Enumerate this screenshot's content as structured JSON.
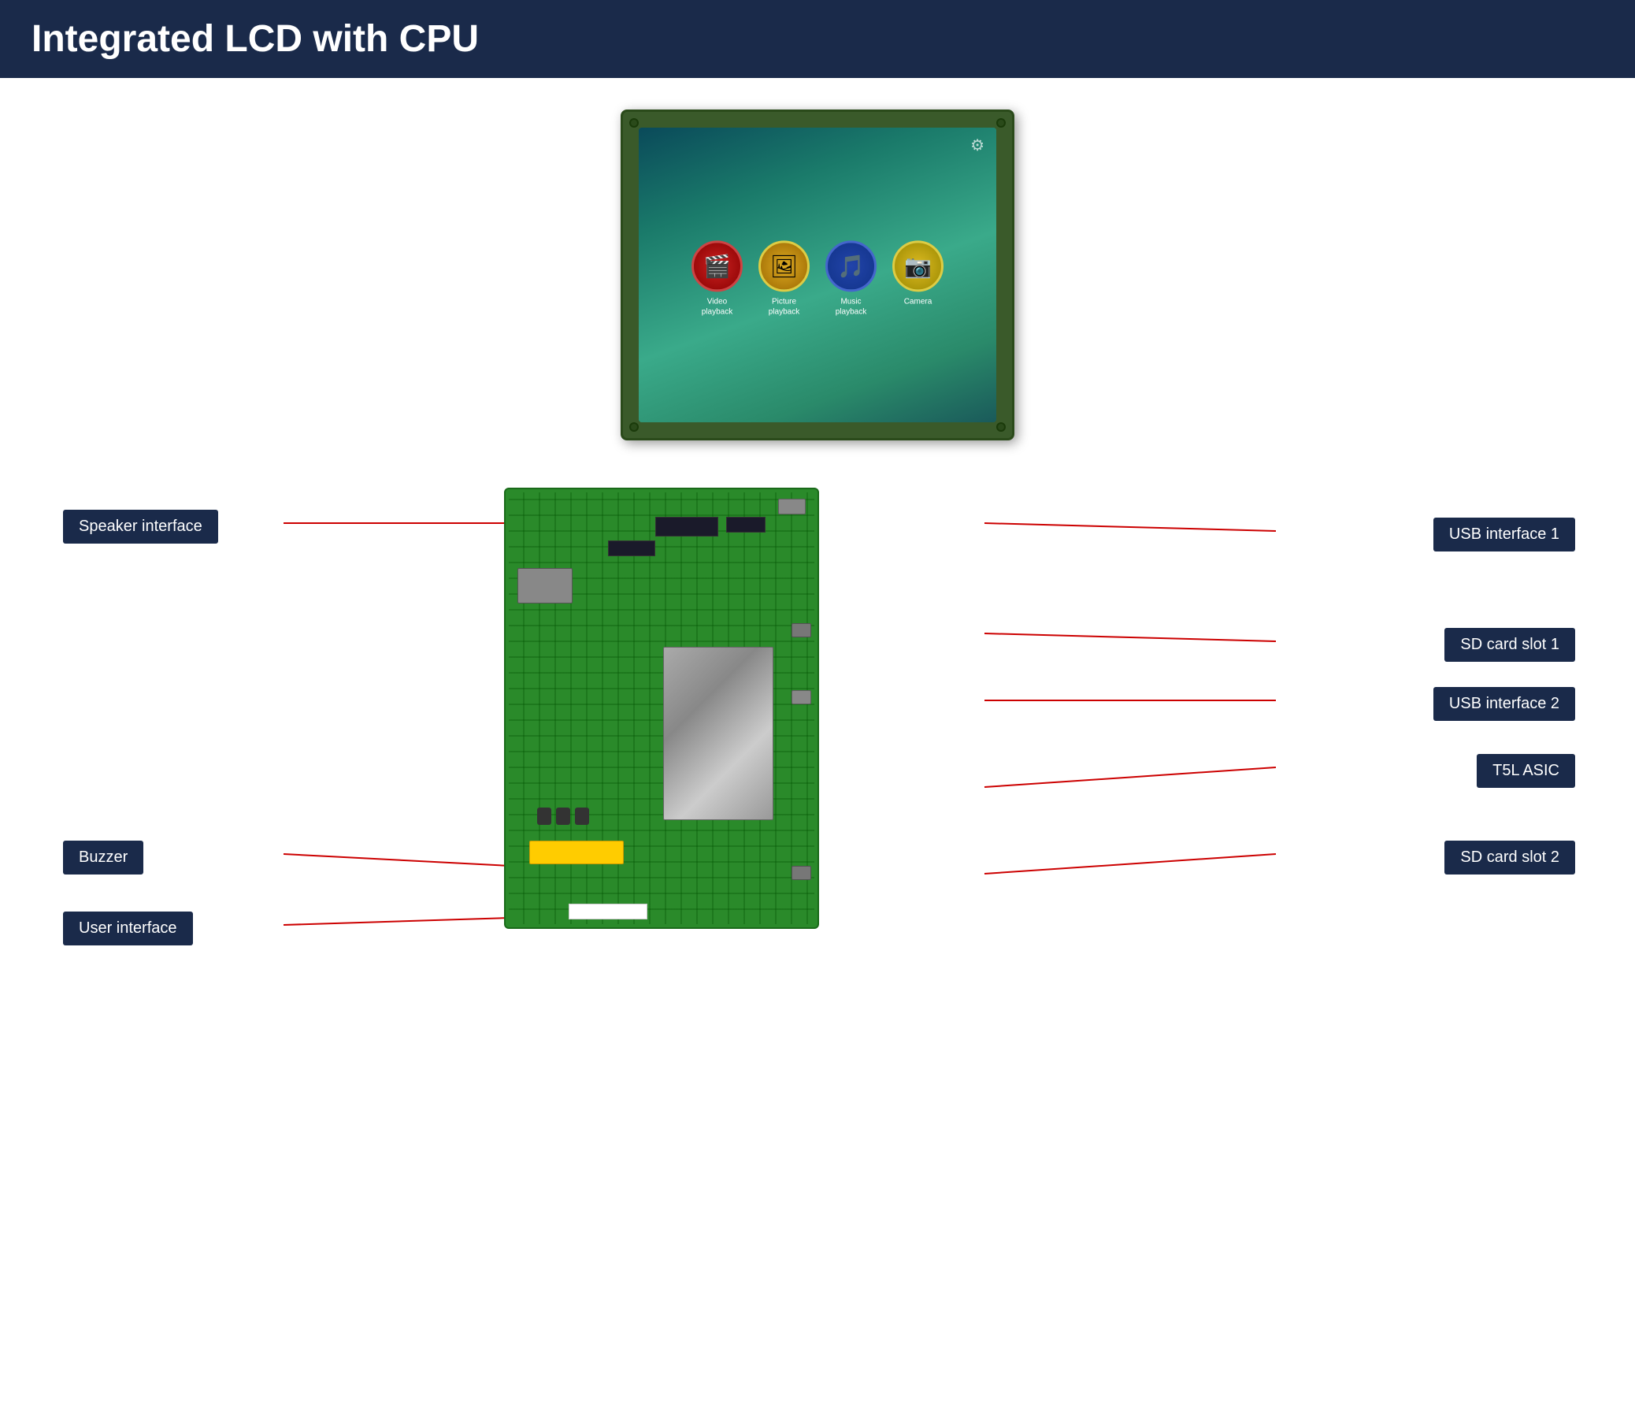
{
  "header": {
    "title": "Integrated LCD with CPU"
  },
  "lcd": {
    "settings_icon": "⚙",
    "apps": [
      {
        "id": "video",
        "label": "Video\nplayback",
        "icon": "🎬",
        "class": "app-video"
      },
      {
        "id": "picture",
        "label": "Picture\nplayback",
        "icon": "🖼",
        "class": "app-picture"
      },
      {
        "id": "music",
        "label": "Music\nplayback",
        "icon": "🎵",
        "class": "app-music"
      },
      {
        "id": "camera",
        "label": "Camera",
        "icon": "📷",
        "class": "app-camera"
      }
    ]
  },
  "labels": {
    "speaker_interface": "Speaker interface",
    "usb_interface_1": "USB interface 1",
    "sd_card_slot_1": "SD card slot 1",
    "usb_interface_2": "USB interface 2",
    "t5l_asic": "T5L ASIC",
    "sd_card_slot_2": "SD card slot 2",
    "buzzer": "Buzzer",
    "user_interface": "User interface"
  }
}
